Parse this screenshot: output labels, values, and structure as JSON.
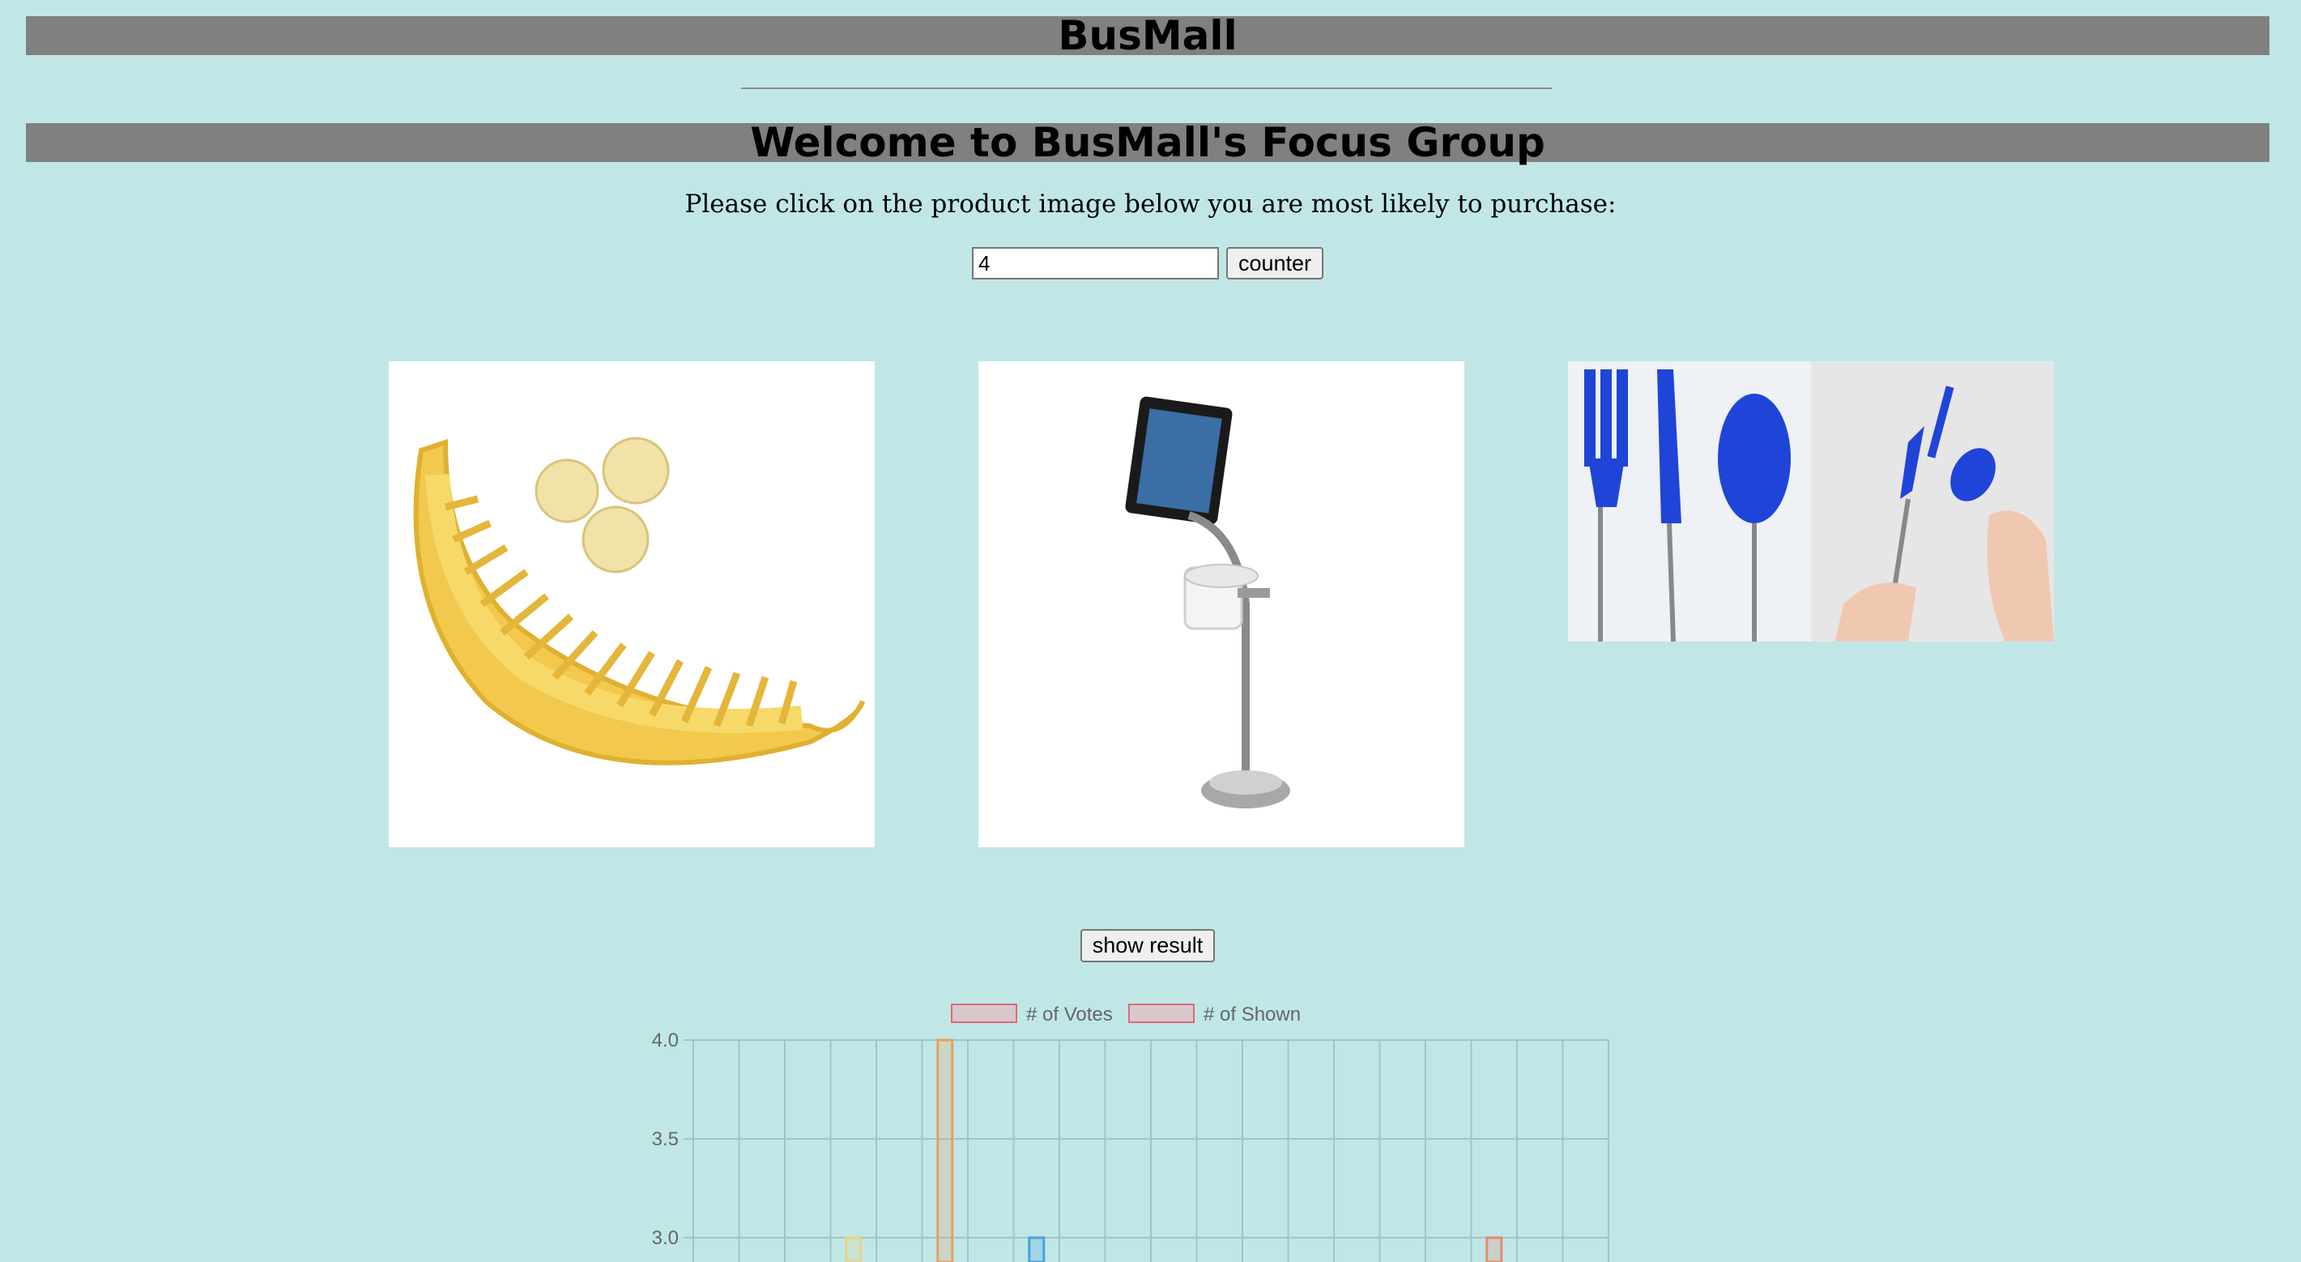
{
  "header": {
    "title": "BusMall"
  },
  "main": {
    "welcome": "Welcome to BusMall's Focus Group",
    "instructions": "Please click on the product image below you are most likely to purchase:",
    "counter_value": "4",
    "counter_button": "counter",
    "show_result_button": "show result"
  },
  "products": [
    {
      "icon": "banana-slicer-image"
    },
    {
      "icon": "bathroom-tablet-stand-image"
    },
    {
      "icon": "pen-utensils-image"
    }
  ],
  "chart_data": {
    "type": "bar",
    "legend": [
      "# of Votes",
      "# of Shown"
    ],
    "yticks": [
      "4.0",
      "3.5",
      "3.0"
    ],
    "ylim_visible": [
      3.0,
      4.0
    ],
    "category_count": 20,
    "series": [
      {
        "name": "# of Votes",
        "values": [
          null,
          null,
          null,
          3,
          null,
          4,
          null,
          3,
          null,
          null,
          null,
          null,
          null,
          null,
          null,
          null,
          null,
          3,
          null,
          null
        ]
      }
    ],
    "bar_colors": [
      "#e8d28a",
      "#e8a060",
      "#4aa0e0",
      "#e88a70"
    ]
  }
}
